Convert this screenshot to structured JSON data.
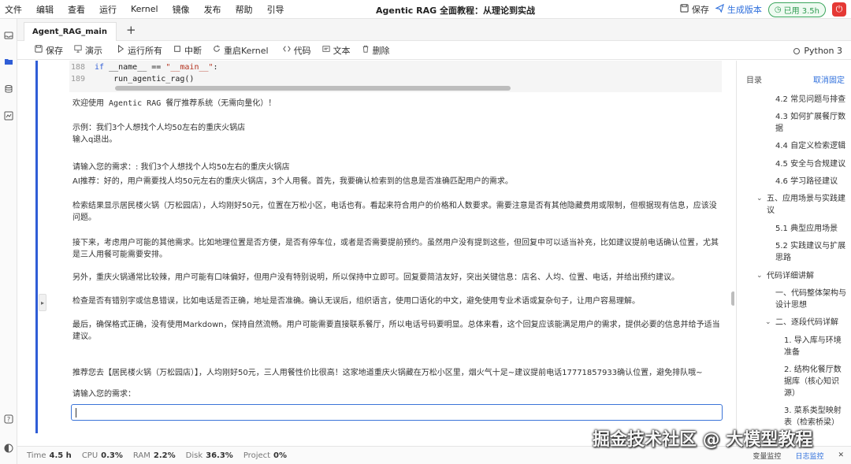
{
  "menu": [
    "文件",
    "编辑",
    "查看",
    "运行",
    "Kernel",
    "镜像",
    "发布",
    "帮助",
    "引导"
  ],
  "title": "Agentic RAG 全面教程：从理论到实战",
  "actions": {
    "save": "保存",
    "publish": "生成版本",
    "used": "已用 3.5h"
  },
  "tab": {
    "name": "Agent_RAG_main",
    "add": "+"
  },
  "toolbar": [
    {
      "icon": "save-icon",
      "label": "保存"
    },
    {
      "icon": "presentation-icon",
      "label": "演示"
    },
    {
      "icon": "play-icon",
      "label": "运行所有"
    },
    {
      "icon": "stop-icon",
      "label": "中断"
    },
    {
      "icon": "restart-icon",
      "label": "重启Kernel"
    },
    {
      "icon": "code-icon",
      "label": "代码"
    },
    {
      "icon": "text-icon",
      "label": "文本"
    },
    {
      "icon": "trash-icon",
      "label": "删除"
    }
  ],
  "kernel": "Python 3",
  "code": [
    {
      "line": "188",
      "pre": "",
      "kw": "if",
      "mid": " __name__ == ",
      "str": "\"__main__\"",
      "post": ":"
    },
    {
      "line": "189",
      "pre": "    run_agentic_rag()",
      "kw": "",
      "mid": "",
      "str": "",
      "post": ""
    }
  ],
  "output": {
    "welcome": "欢迎使用 Agentic RAG 餐厅推荐系统（无需向量化）！",
    "example": "示例：我们3个人想找个人均50左右的重庆火锅店",
    "quit": "输入q退出。",
    "prompt1": "请输入您的需求：: 我们3个人想找个人均50左右的重庆火锅店",
    "ai": "AI推荐：好的，用户需要找人均50元左右的重庆火锅店，3个人用餐。首先，我要确认检索到的信息是否准确匹配用户的需求。",
    "p1": "检索结果显示居民楼火锅（万松园店），人均刚好50元，位置在万松小区，电话也有。看起来符合用户的价格和人数要求。需要注意是否有其他隐藏费用或限制，但根据现有信息，应该没问题。",
    "p2": "接下来，考虑用户可能的其他需求。比如地理位置是否方便，是否有停车位，或者是否需要提前预约。虽然用户没有提到这些，但回复中可以适当补充，比如建议提前电话确认位置，尤其是三人用餐可能需要安排。",
    "p3": "另外，重庆火锅通常比较辣，用户可能有口味偏好，但用户没有特别说明，所以保持中立即可。回复要简洁友好，突出关键信息：店名、人均、位置、电话，并给出预约建议。",
    "p4": "检查是否有错别字或信息错误，比如电话是否正确，地址是否准确。确认无误后，组织语言，使用口语化的中文，避免使用专业术语或复杂句子，让用户容易理解。",
    "p5": "最后，确保格式正确，没有使用Markdown，保持自然流畅。用户可能需要直接联系餐厅，所以电话号码要明显。总体来看，这个回复应该能满足用户的需求，提供必要的信息并给予适当建议。",
    "rec": "推荐您去【居民楼火锅（万松园店）】，人均刚好50元，三人用餐性价比很高！这家地道重庆火锅藏在万松小区里，烟火气十足~建议提前电话17771857933确认位置，避免排队哦~",
    "prompt2": "请输入您的需求："
  },
  "toc": {
    "header": "目录",
    "collapse": "取消固定",
    "items": [
      "4.2 常见问题与排查",
      "4.3 如何扩展餐厅数据",
      "4.4 自定义检索逻辑",
      "4.5 安全与合规建议",
      "4.6 学习路径建议",
      "五、应用场景与实践建议",
      "5.1 典型应用场景",
      "5.2 实践建议与扩展思路",
      "代码详细讲解",
      "一、代码整体架构与设计思想",
      "二、逐段代码详解",
      "1. 导入库与环境准备",
      "2. 结构化餐厅数据库（核心知识源）",
      "3. 菜系类型映射表（检索桥梁）"
    ]
  },
  "status": {
    "time_label": "Time",
    "time": "4.5 h",
    "cpu_label": "CPU",
    "cpu": "0.3%",
    "ram_label": "RAM",
    "ram": "2.2%",
    "disk_label": "Disk",
    "disk": "36.3%",
    "project_label": "Project",
    "project": "0%",
    "var_monitor": "变量监控",
    "log_monitor": "日志监控"
  },
  "watermark": "掘金技术社区 @ 大模型教程"
}
